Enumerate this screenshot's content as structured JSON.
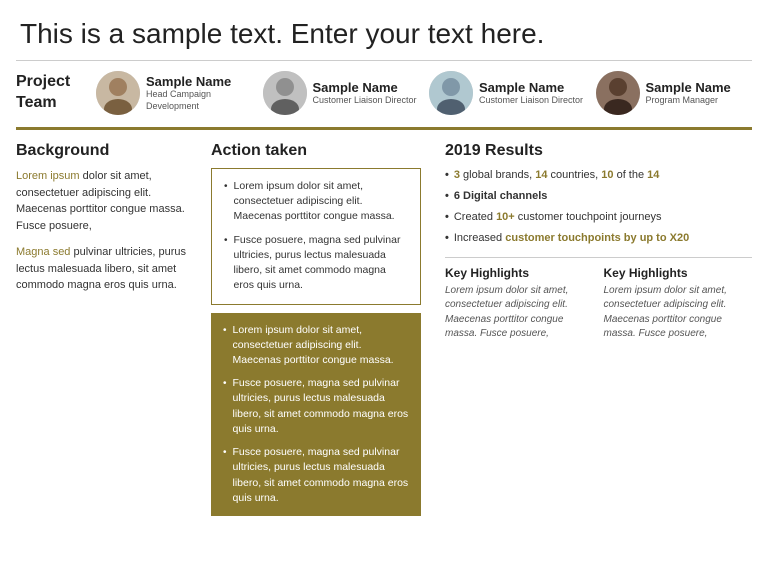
{
  "header": {
    "title": "This is a sample text. Enter your text here."
  },
  "team": {
    "label": "Project\nTeam",
    "members": [
      {
        "name": "Sample Name",
        "role": "Head Campaign Development"
      },
      {
        "name": "Sample Name",
        "role": "Customer Liaison Director"
      },
      {
        "name": "Sample Name",
        "role": "Customer Liaison Director"
      },
      {
        "name": "Sample Name",
        "role": "Program Manager"
      }
    ]
  },
  "background": {
    "title": "Background",
    "paragraph1_highlight": "Lorem ipsum",
    "paragraph1_rest": " dolor sit amet, consectetuer adipiscing elit. Maecenas porttitor congue massa. Fusce posuere,",
    "paragraph2_highlight": "Magna sed",
    "paragraph2_rest": " pulvinar ultricies, purus lectus malesuada libero, sit amet commodo magna eros quis urna."
  },
  "action": {
    "title": "Action taken",
    "white_box": [
      "Lorem ipsum dolor sit amet, consectetuer adipiscing elit. Maecenas porttitor congue massa.",
      "Fusce posuere, magna sed pulvinar ultricies, purus lectus malesuada libero, sit amet commodo magna eros quis urna."
    ],
    "olive_box": [
      "Lorem ipsum dolor sit amet, consectetuer adipiscing elit. Maecenas porttitor congue massa.",
      "Fusce posuere, magna sed pulvinar ultricies, purus lectus malesuada libero, sit amet commodo magna eros quis urna.",
      "Fusce posuere, magna sed pulvinar ultricies, purus lectus malesuada libero, sit amet commodo magna eros quis urna."
    ]
  },
  "results": {
    "title": "2019 Results",
    "items": [
      {
        "text": "3 global brands,",
        "bold": "3",
        "highlight": "14",
        "rest": " countries, ",
        "highlight2": "10",
        "rest2": " of the ",
        "highlight3": "14"
      },
      {
        "text": "6 Digital channels",
        "bold_all": true
      },
      {
        "text": "Created ",
        "highlight": "10+",
        "rest": " customer touchpoint journeys"
      },
      {
        "text": "Increased ",
        "highlight": "customer touchpoints by up to X20"
      }
    ],
    "key_highlights": [
      {
        "title": "Key Highlights",
        "text": "Lorem ipsum dolor sit amet, consectetuer adipiscing elit. Maecenas porttitor congue massa. Fusce posuere,"
      },
      {
        "title": "Key Highlights",
        "text": "Lorem ipsum dolor sit amet, consectetuer adipiscing elit. Maecenas porttitor congue massa. Fusce posuere,"
      }
    ]
  }
}
